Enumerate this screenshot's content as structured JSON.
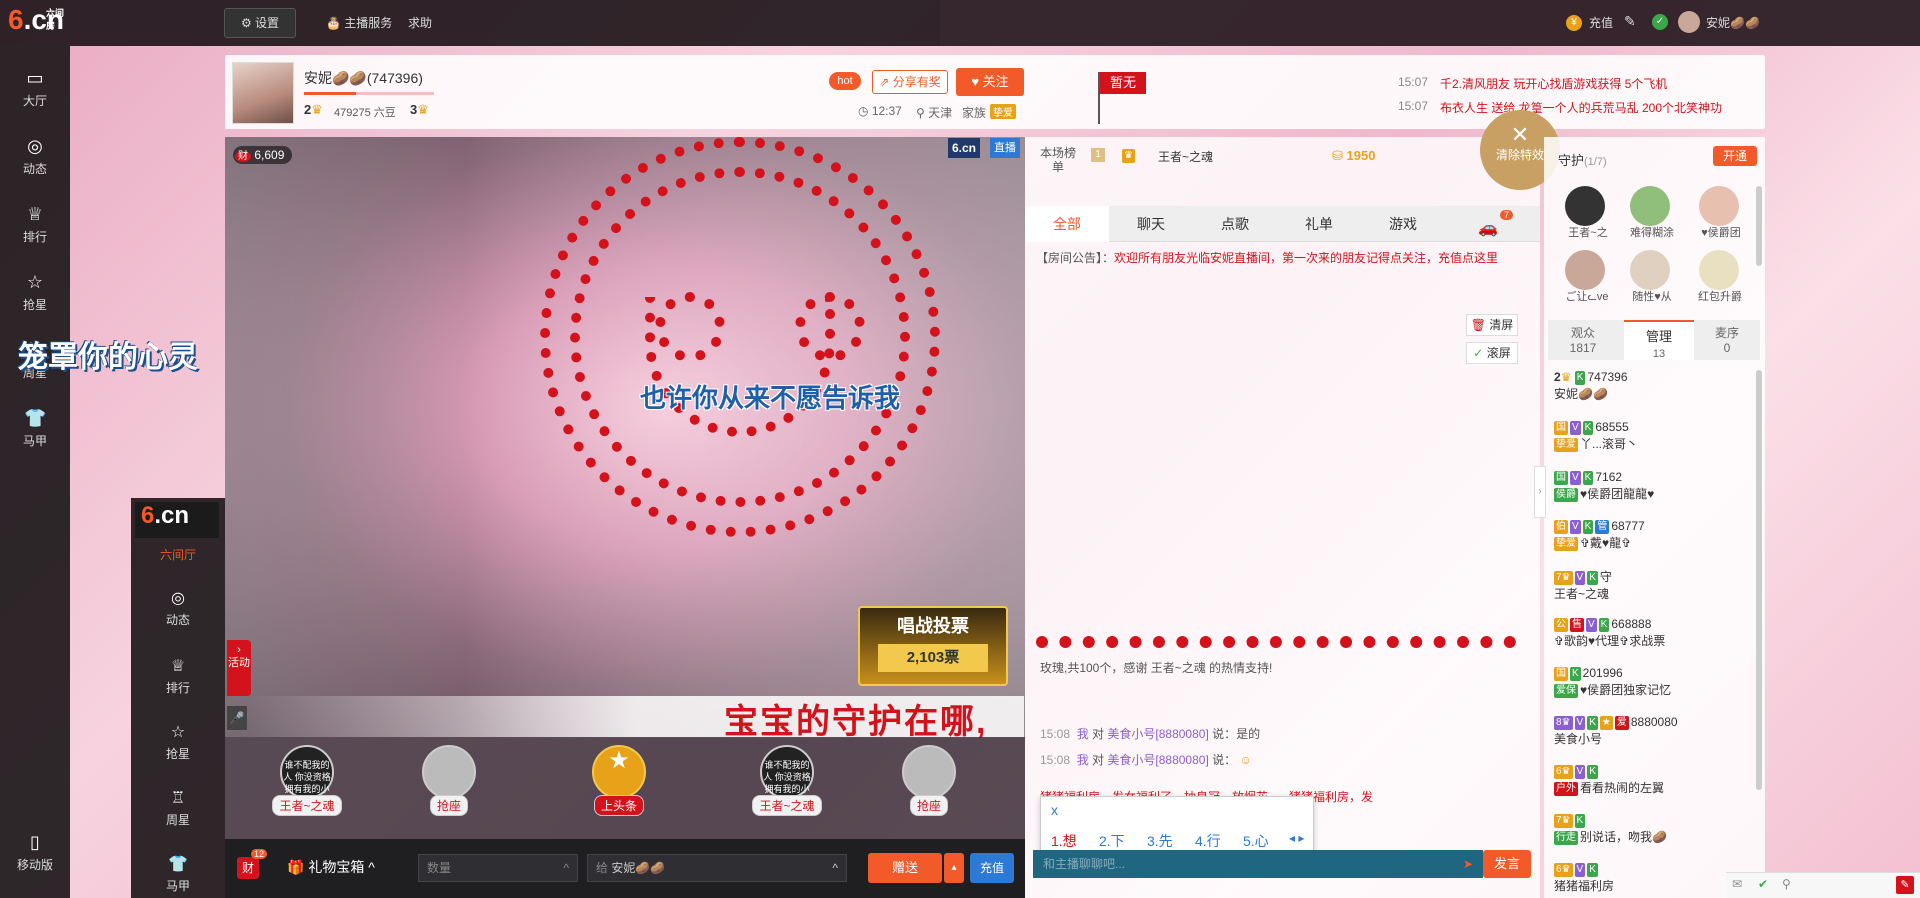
{
  "topbar": {
    "settings": "设置",
    "host_service": "主播服务",
    "help": "求助",
    "recharge": "充值",
    "username": "安妮🥔🥔"
  },
  "logo": {
    "text": "6.cn",
    "sub": "六间房"
  },
  "leftnav": [
    {
      "label": "大厅",
      "icon": "tv-icon"
    },
    {
      "label": "动态",
      "icon": "compass-icon"
    },
    {
      "label": "排行",
      "icon": "crown-icon"
    },
    {
      "label": "抢星",
      "icon": "star-icon"
    },
    {
      "label": "周星",
      "icon": "cup-icon"
    },
    {
      "label": "马甲",
      "icon": "shirt-icon"
    }
  ],
  "leftnav_bottom": {
    "label": "移动版"
  },
  "overlay_text": "笼罩你的心灵",
  "nav2": {
    "logo": "6.cn",
    "logo_sub": "六间房",
    "items": [
      "六间厅",
      "动态",
      "排行",
      "抢星",
      "周星",
      "马甲"
    ]
  },
  "header": {
    "host_name": "安妮🥔🥔(747396)",
    "level": "2",
    "beans": "479275 六豆",
    "rank": "3",
    "hot": "hot",
    "share": "分享有奖",
    "follow": "关注",
    "time": "12:37",
    "city": "天津",
    "family": "家族",
    "family_tag": "挚爱",
    "flag": "暂无",
    "news": [
      {
        "time": "15:07",
        "text": "千2.清风朋友 玩开心找盾游戏获得 5个飞机"
      },
      {
        "time": "15:07",
        "text": "布衣人生 送给 龙篁一个人的兵荒马乱 200个北笑神功"
      }
    ]
  },
  "video": {
    "wealth": "6,609",
    "brand": "6.cn",
    "live": "直播",
    "lyric1": "也许你从来不愿告诉我",
    "lyric2": "宝宝的守护在哪,",
    "vote_title": "唱战投票",
    "vote_count": "2,103票",
    "activity": "活动"
  },
  "seats": [
    {
      "name": "王者~之魂",
      "note": "谁不配我的人 你没资格拥有我的小情敌"
    },
    {
      "name": "抢座",
      "note": ""
    },
    {
      "name": "上头条",
      "note": ""
    },
    {
      "name": "王者~之魂",
      "note": "谁不配我的人 你没资格拥有我的小情敌"
    },
    {
      "name": "抢座",
      "note": ""
    }
  ],
  "giftbar": {
    "wealth_badge": "12",
    "wealth_label": "财",
    "gift_box": "礼物宝箱",
    "qty_placeholder": "数量",
    "to_label": "给",
    "to_name": "安妮🥔🥔",
    "send": "赠送",
    "recharge": "充值"
  },
  "rank": {
    "label": "本场榜单",
    "pos": "1",
    "user": "王者~之魂",
    "score": "1950"
  },
  "clear_effects": "清除特效",
  "chat_tabs": [
    "全部",
    "聊天",
    "点歌",
    "礼单",
    "游戏"
  ],
  "chat_tab_badge": "7",
  "announcement_label": "【房间公告】：",
  "announcement": "欢迎所有朋友光临安妮直播间，第一次来的朋友记得点关注，充值点这里",
  "clear_screen": "清屏",
  "scroll_screen": "滚屏",
  "gift_msg": "玫瑰,共100个，感谢 王者~之魂 的热情支持!",
  "messages": [
    {
      "time": "15:08",
      "from": "我",
      "to": "美食小号[8880080]",
      "text": "说：是的"
    },
    {
      "time": "15:08",
      "from": "我",
      "to": "美食小号[8880080]",
      "text": "说："
    }
  ],
  "system_msg": "猪猪福利房，发女福利了，抽皇冠，放烟花~~~猪猪福利房，发",
  "ime": {
    "input": "x",
    "candidates": [
      "1.想",
      "2.下",
      "3.先",
      "4.行",
      "5.心"
    ]
  },
  "chat_input_placeholder": "和主播聊聊吧...",
  "chat_send": "发言",
  "guard": {
    "title": "守护",
    "count": "(1/7)",
    "open": "开通",
    "members": [
      "王者~之",
      "难得糊涂",
      "♥侯爵团",
      "ご让ᓚve",
      "随性♥从",
      "红包升爵"
    ]
  },
  "user_tabs": [
    {
      "label": "观众",
      "count": "1817"
    },
    {
      "label": "管理",
      "count": "13"
    },
    {
      "label": "麦序",
      "count": "0"
    }
  ],
  "users": [
    {
      "id": "747396",
      "name": "安妮🥔🥔"
    },
    {
      "id": "68555",
      "name": "丫...滚哥丶"
    },
    {
      "id": "7162",
      "name": "♥侯爵团龍龍♥"
    },
    {
      "id": "68777",
      "name": "✞戴♥龍✞"
    },
    {
      "id": "守",
      "name": "王者~之魂"
    },
    {
      "id": "668888",
      "name": "✞歌韵♥代理✞求战票"
    },
    {
      "id": "201996",
      "name": "♥侯爵团独家记忆"
    },
    {
      "id": "8880080",
      "name": "美食小号"
    },
    {
      "id": "",
      "name": "看看热闹的左翼"
    },
    {
      "id": "",
      "name": "别说话，吻我🥔"
    },
    {
      "id": "",
      "name": "猪猪福利房"
    }
  ],
  "colors": {
    "accent": "#f35a2a",
    "rose": "#d4121b",
    "dark": "#1f1f22"
  }
}
